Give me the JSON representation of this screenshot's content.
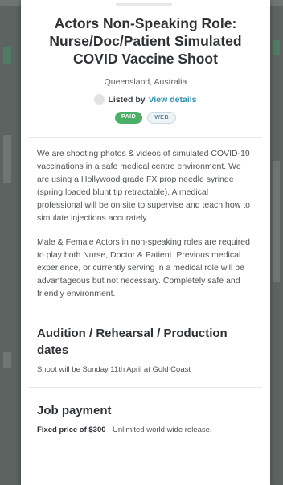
{
  "job": {
    "title": "Actors Non-Speaking Role: Nurse/Doc/Patient Simulated COVID Vaccine Shoot",
    "location": "Queensland, Australia",
    "listed_by_label": "Listed by",
    "listed_by_link": "View details",
    "tags": [
      "PAID",
      "WEB"
    ]
  },
  "description": {
    "paragraphs": [
      "We are shooting photos & videos of simulated COVID-19 vaccinations in a safe medical centre environment. We are using a Hollywood grade FX prop needle syringe (spring loaded blunt tip retractable). A medical professional will be on site to supervise and teach how to simulate injections accurately.",
      "Male & Female Actors in non-speaking roles are required to play both Nurse, Doctor & Patient. Previous medical experience, or currently serving in a medical role will be advantageous but not necessary. Completely safe and friendly environment."
    ]
  },
  "dates": {
    "heading": "Audition / Rehearsal / Production dates",
    "text": "Shoot will be Sunday 11th April at Gold Coast"
  },
  "payment": {
    "heading": "Job payment",
    "strong": "Fixed price of $300",
    "rest": " - Unlimited world wide release."
  },
  "colors": {
    "link": "#2f8fae",
    "paid_tag": "#4caf67",
    "overlay": "#5c6360"
  }
}
